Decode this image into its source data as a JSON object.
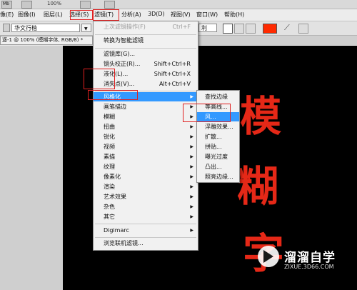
{
  "topbar": {
    "mb_label": "Mb",
    "zoom": "100%"
  },
  "menubar": {
    "items": [
      "像(E)",
      "图像(I)",
      "图层(L)",
      "选择(S)",
      "滤镜(T)",
      "分析(A)",
      "3D(D)",
      "视图(V)",
      "窗口(W)",
      "帮助(H)"
    ]
  },
  "options": {
    "font": "华文行楷",
    "mode": "利",
    "accent_color": "#ff2a00"
  },
  "document": {
    "tab_label": "逐-1 @ 100% (模糊字体, RGB/8) *"
  },
  "canvas": {
    "text_chars": [
      "模",
      "糊",
      "字"
    ]
  },
  "filter_menu": {
    "items": [
      {
        "label": "上次滤镜操作(F)",
        "shortcut": "Ctrl+F",
        "disabled": true
      },
      {
        "label": "转换为智能滤镜"
      },
      {
        "label": "滤镜库(G)..."
      },
      {
        "label": "镜头校正(R)...",
        "shortcut": "Shift+Ctrl+R"
      },
      {
        "label": "液化(L)...",
        "shortcut": "Shift+Ctrl+X"
      },
      {
        "label": "消失点(V)...",
        "shortcut": "Alt+Ctrl+V"
      },
      {
        "label": "风格化",
        "submenu": true,
        "highlighted": true
      },
      {
        "label": "画笔描边",
        "submenu": true
      },
      {
        "label": "模糊",
        "submenu": true
      },
      {
        "label": "扭曲",
        "submenu": true
      },
      {
        "label": "锐化",
        "submenu": true
      },
      {
        "label": "视频",
        "submenu": true
      },
      {
        "label": "素描",
        "submenu": true
      },
      {
        "label": "纹理",
        "submenu": true
      },
      {
        "label": "像素化",
        "submenu": true
      },
      {
        "label": "渲染",
        "submenu": true
      },
      {
        "label": "艺术效果",
        "submenu": true
      },
      {
        "label": "杂色",
        "submenu": true
      },
      {
        "label": "其它",
        "submenu": true
      },
      {
        "label": "Digimarc",
        "submenu": true
      },
      {
        "label": "浏览联机滤镜..."
      }
    ]
  },
  "stylize_submenu": {
    "items": [
      {
        "label": "查找边缘"
      },
      {
        "label": "等高线..."
      },
      {
        "label": "风...",
        "highlighted": true
      },
      {
        "label": "浮雕效果..."
      },
      {
        "label": "扩散..."
      },
      {
        "label": "拼贴..."
      },
      {
        "label": "曝光过度"
      },
      {
        "label": "凸出..."
      },
      {
        "label": "照亮边缘..."
      }
    ]
  },
  "watermark": {
    "title": "溜溜自学",
    "subtitle": "ZIXUE.3D66.COM"
  }
}
